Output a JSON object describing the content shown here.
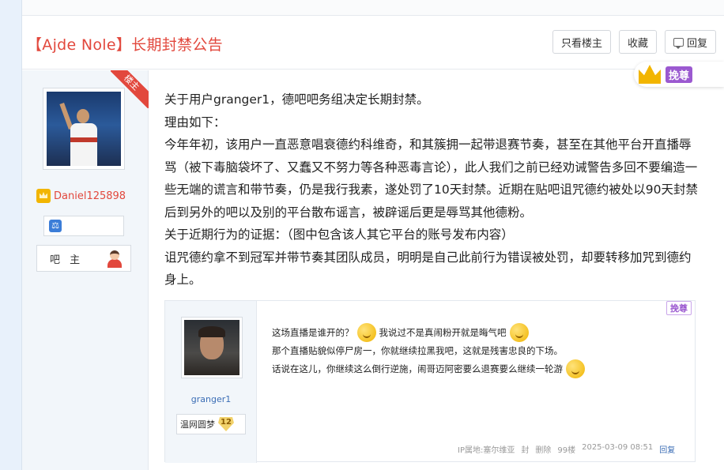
{
  "post": {
    "title": "【Ajde Nole】长期封禁公告",
    "buttons": {
      "only_owner": "只看楼主",
      "favorite": "收藏",
      "reply": "回复"
    }
  },
  "author": {
    "ribbon": "楼主",
    "username": "Daniel125898",
    "role": "吧 主"
  },
  "tip_badge": "挽尊",
  "content": {
    "paragraphs": [
      "关于用户granger1，德吧吧务组决定长期封禁。",
      "理由如下：",
      "今年年初，该用户一直恶意唱衰德约科维奇，和其簇拥一起带退赛节奏，甚至在其他平台开直播辱骂（被下毒脑袋坏了、又蠢又不努力等各种恶毒言论），此人我们之前已经劝诫警告多回不要编造一些无端的谎言和带节奏，仍是我行我素，遂处罚了10天封禁。近期在贴吧诅咒德约被处以90天封禁后到另外的吧以及别的平台散布谣言，被辟谣后更是辱骂其他德粉。",
      "关于近期行为的证据：（图中包含该人其它平台的账号发布内容）",
      "诅咒德约拿不到冠军并带节奏其团队成员，明明是自己此前行为错误被处罚，却要转移加咒到德约身上。"
    ]
  },
  "embed": {
    "username": "granger1",
    "level_name": "温网圆梦",
    "level_num": "12",
    "tip": "挽尊",
    "lines": {
      "l1a": "这场直播是谁开的？",
      "l1b": "我说过不是真闹粉开就是晦气吧",
      "l2": "那个直播贴貌似停尸房一，你就继续拉黑我吧，这就是残害忠良的下场。",
      "l3": "话说在这儿，你继续这么倒行逆施，闹哥迈阿密要么退赛要么继续一轮游"
    },
    "footer": {
      "ip": "IP属地:塞尔维亚",
      "ban": "封",
      "delete": "删除",
      "floor": "99楼",
      "time": "2025-03-09 08:51",
      "reply": "回复"
    }
  },
  "colors": {
    "accent": "#e2483d",
    "tip": "#9b59d0",
    "link": "#3b6db5"
  }
}
